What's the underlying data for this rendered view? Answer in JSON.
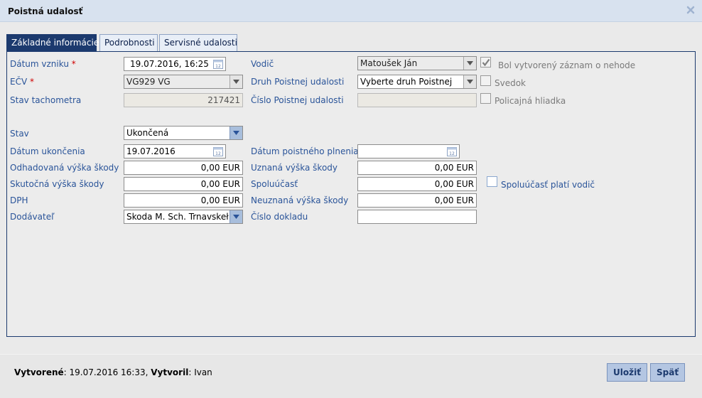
{
  "window": {
    "title": "Poistná udalosť",
    "close_icon": "close-icon"
  },
  "tabs": [
    {
      "label": "Základné informácie",
      "active": true
    },
    {
      "label": "Podrobnosti",
      "active": false
    },
    {
      "label": "Servisné udalosti",
      "active": false
    }
  ],
  "form": {
    "datum_vzniku": {
      "label": "Dátum vzniku",
      "required": "*",
      "value": "19.07.2016, 16:25"
    },
    "ecv": {
      "label": "EČV",
      "required": "*",
      "value": "VG929 VG"
    },
    "stav_tachometra": {
      "label": "Stav tachometra",
      "value": "217421"
    },
    "vodic": {
      "label": "Vodič",
      "value": "Matoušek Ján"
    },
    "druh_poistnej_udalosti": {
      "label": "Druh Poistnej udalosti",
      "value": "Vyberte druh Poistnej"
    },
    "cislo_poistnej_udalosti": {
      "label": "Číslo Poistnej udalosti",
      "value": ""
    },
    "bol_vytvoreny_zaznam": {
      "label": "Bol vytvorený záznam o nehode",
      "checked": true
    },
    "svedok": {
      "label": "Svedok",
      "checked": false
    },
    "policajna_hliadka": {
      "label": "Policajná hliadka",
      "checked": false
    },
    "stav": {
      "label": "Stav",
      "value": "Ukončená"
    },
    "datum_ukoncenia": {
      "label": "Dátum ukončenia",
      "value": "19.07.2016"
    },
    "odhadovana_vyska_skody": {
      "label": "Odhadovaná výška škody",
      "value": "0,00 EUR"
    },
    "skutocna_vyska_skody": {
      "label": "Skutočná výška škody",
      "value": "0,00 EUR"
    },
    "dph": {
      "label": "DPH",
      "value": "0,00 EUR"
    },
    "dodavatel": {
      "label": "Dodávateľ",
      "value": "Skoda M. Sch. Trnavskeł"
    },
    "datum_poistneho_plnenia": {
      "label": "Dátum poistného plnenia",
      "value": ""
    },
    "uznana_vyska_skody": {
      "label": "Uznaná výška škody",
      "value": "0,00 EUR"
    },
    "spoluucast": {
      "label": "Spoluúčasť",
      "value": "0,00 EUR"
    },
    "neuznana_vyska_skody": {
      "label": "Neuznaná výška škody",
      "value": "0,00 EUR"
    },
    "cislo_dokladu": {
      "label": "Číslo dokladu",
      "value": ""
    },
    "spoluucast_plati_vodic": {
      "label": "Spoluúčasť platí vodič",
      "checked": false
    }
  },
  "footer": {
    "created_label": "Vytvorené",
    "created_value": "19.07.2016 16:33,",
    "created_by_label": "Vytvoril",
    "created_by_value": "Ivan",
    "save_label": "Uložiť",
    "back_label": "Späť"
  },
  "colors": {
    "accent": "#1c3a6e",
    "label": "#2a5499",
    "required": "#d00000"
  }
}
